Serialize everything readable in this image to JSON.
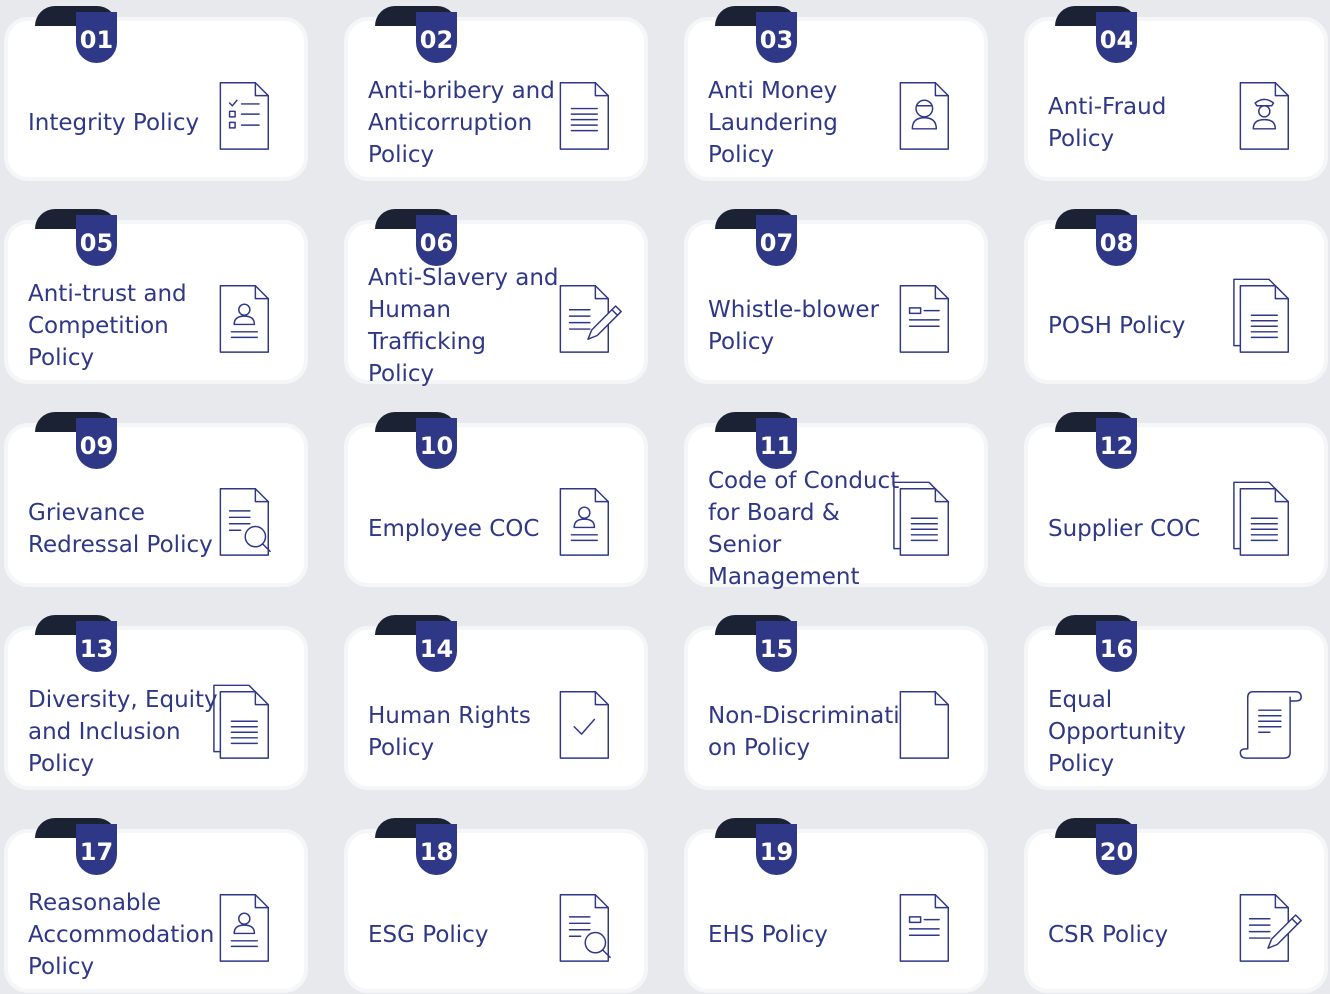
{
  "accent": "#2f3787",
  "tab_color": "#1b2233",
  "cards": [
    {
      "num": "01",
      "title": "Integrity Policy",
      "icon": "checklist-icon"
    },
    {
      "num": "02",
      "title": "Anti-bribery and Anticorruption Policy",
      "icon": "document-icon"
    },
    {
      "num": "03",
      "title": "Anti Money Laundering Policy",
      "icon": "thief-document-icon"
    },
    {
      "num": "04",
      "title": "Anti-Fraud Policy",
      "icon": "fraud-document-icon"
    },
    {
      "num": "05",
      "title": "Anti-trust and Competition Policy",
      "icon": "person-document-icon"
    },
    {
      "num": "06",
      "title": "Anti-Slavery and Human Trafficking Policy",
      "icon": "document-pen-icon"
    },
    {
      "num": "07",
      "title": "Whistle-blower Policy",
      "icon": "form-document-icon"
    },
    {
      "num": "08",
      "title": "POSH Policy",
      "icon": "stacked-documents-icon"
    },
    {
      "num": "09",
      "title": "Grievance Redressal Policy",
      "icon": "document-search-icon"
    },
    {
      "num": "10",
      "title": "Employee COC",
      "icon": "person-document-icon"
    },
    {
      "num": "11",
      "title": "Code of Conduct for Board & Senior Management",
      "icon": "stacked-documents-icon"
    },
    {
      "num": "12",
      "title": "Supplier COC",
      "icon": "stacked-documents-icon"
    },
    {
      "num": "13",
      "title": "Diversity, Equity, and Inclusion Policy",
      "icon": "stacked-documents-icon"
    },
    {
      "num": "14",
      "title": "Human Rights Policy",
      "icon": "check-document-icon"
    },
    {
      "num": "15",
      "title": "Non-Discrimination Policy",
      "icon": "blank-document-icon"
    },
    {
      "num": "16",
      "title": "Equal Opportunity Policy",
      "icon": "scroll-icon"
    },
    {
      "num": "17",
      "title": "Reasonable Accommodation Policy",
      "icon": "person-document-icon"
    },
    {
      "num": "18",
      "title": "ESG Policy",
      "icon": "document-search-icon"
    },
    {
      "num": "19",
      "title": "EHS Policy",
      "icon": "form-document-icon"
    },
    {
      "num": "20",
      "title": "CSR Policy",
      "icon": "document-pen-icon"
    }
  ]
}
